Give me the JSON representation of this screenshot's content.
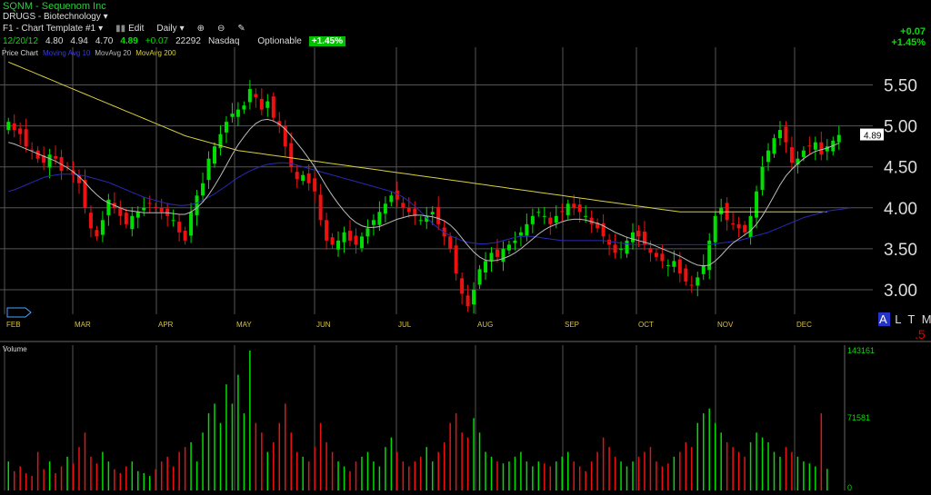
{
  "header": {
    "ticker_line": "SQNM - Sequenom Inc",
    "sector_line": "DRUGS - Biotechnology",
    "template": "F1 - Chart Template #1",
    "edit": "Edit",
    "period": "Daily",
    "zoom_in_icon": "zoom-in-icon",
    "zoom_out_icon": "zoom-out-icon",
    "draw_icon": "pencil-icon"
  },
  "quote": {
    "date": "12/20/12",
    "open": "4.80",
    "high": "4.94",
    "low": "4.70",
    "close": "4.89",
    "change": "+0.07",
    "volume": "22292",
    "exchange": "Nasdaq",
    "optionable": "Optionable",
    "pct_badge": "+1.45%",
    "right_change": "+0.07",
    "right_pct": "+1.45%"
  },
  "legend": {
    "price": "Price Chart",
    "ma10": "Moving Avg 10",
    "ma20": "MovAvg 20",
    "ma200": "MovAvg 200"
  },
  "controls": {
    "a": "A",
    "ltml": "L T M L",
    "five": ".5"
  },
  "colors": {
    "up": "#00dd00",
    "down": "#ee1111",
    "ma10": "#2a2ab8",
    "ma20": "#bbbbbb",
    "ma200": "#d8d040",
    "grid": "#555555",
    "axis_text": "#dddddd",
    "month_text": "#d8c040"
  },
  "chart_data": {
    "type": "candlestick",
    "price_axis": {
      "ylim": [
        2.7,
        5.85
      ],
      "ticks": [
        "5.50",
        "5.00",
        "4.50",
        "4.00",
        "3.50",
        "3.00"
      ],
      "last_label": "4.89"
    },
    "months": [
      "FEB",
      "MAR",
      "APR",
      "MAY",
      "JUN",
      "JUL",
      "AUG",
      "SEP",
      "OCT",
      "NOV",
      "DEC"
    ],
    "close": [
      5.05,
      4.95,
      4.9,
      4.75,
      4.7,
      4.6,
      4.55,
      4.65,
      4.6,
      4.45,
      4.5,
      4.4,
      4.3,
      4.0,
      3.75,
      3.65,
      3.85,
      4.1,
      4.0,
      3.9,
      3.8,
      3.9,
      3.95,
      4.0,
      4.05,
      4.0,
      3.95,
      3.9,
      3.85,
      3.7,
      3.6,
      3.95,
      4.15,
      4.3,
      4.6,
      4.75,
      4.9,
      5.05,
      5.15,
      5.2,
      5.25,
      5.45,
      5.35,
      5.2,
      5.3,
      5.1,
      5.0,
      4.75,
      4.5,
      4.35,
      4.4,
      4.3,
      4.2,
      3.85,
      3.6,
      3.55,
      3.6,
      3.7,
      3.6,
      3.55,
      3.65,
      3.75,
      3.85,
      3.95,
      4.05,
      4.15,
      4.1,
      4.0,
      3.95,
      3.9,
      3.85,
      3.9,
      3.95,
      3.8,
      3.65,
      3.5,
      3.2,
      2.95,
      2.8,
      3.0,
      3.25,
      3.35,
      3.45,
      3.4,
      3.5,
      3.55,
      3.6,
      3.7,
      3.8,
      3.9,
      3.95,
      3.9,
      3.8,
      3.9,
      3.95,
      4.05,
      4.0,
      3.95,
      3.9,
      3.8,
      3.75,
      3.65,
      3.55,
      3.45,
      3.5,
      3.6,
      3.7,
      3.65,
      3.55,
      3.45,
      3.4,
      3.35,
      3.3,
      3.35,
      3.2,
      3.1,
      3.05,
      3.15,
      3.3,
      3.6,
      3.9,
      4.0,
      3.85,
      3.8,
      3.75,
      3.7,
      3.9,
      4.2,
      4.5,
      4.7,
      4.85,
      4.95,
      4.8,
      4.55,
      4.6,
      4.7,
      4.75,
      4.8,
      4.65,
      4.75,
      4.82,
      4.89
    ],
    "ma20": [
      4.8,
      4.78,
      4.75,
      4.72,
      4.69,
      4.66,
      4.63,
      4.6,
      4.57,
      4.53,
      4.49,
      4.44,
      4.38,
      4.31,
      4.23,
      4.16,
      4.1,
      4.06,
      4.03,
      4.0,
      3.97,
      3.96,
      3.95,
      3.94,
      3.94,
      3.94,
      3.94,
      3.94,
      3.93,
      3.92,
      3.92,
      3.95,
      4.0,
      4.07,
      4.16,
      4.27,
      4.39,
      4.52,
      4.65,
      4.77,
      4.87,
      4.96,
      5.03,
      5.07,
      5.08,
      5.06,
      5.02,
      4.96,
      4.88,
      4.79,
      4.7,
      4.6,
      4.5,
      4.38,
      4.26,
      4.15,
      4.05,
      3.96,
      3.88,
      3.82,
      3.78,
      3.76,
      3.76,
      3.77,
      3.8,
      3.83,
      3.86,
      3.88,
      3.9,
      3.91,
      3.91,
      3.9,
      3.89,
      3.87,
      3.84,
      3.79,
      3.72,
      3.63,
      3.54,
      3.46,
      3.4,
      3.36,
      3.35,
      3.36,
      3.38,
      3.41,
      3.45,
      3.5,
      3.56,
      3.62,
      3.68,
      3.73,
      3.77,
      3.8,
      3.83,
      3.85,
      3.86,
      3.86,
      3.85,
      3.83,
      3.81,
      3.78,
      3.74,
      3.7,
      3.67,
      3.64,
      3.62,
      3.6,
      3.58,
      3.56,
      3.53,
      3.5,
      3.47,
      3.44,
      3.41,
      3.37,
      3.33,
      3.3,
      3.29,
      3.3,
      3.35,
      3.42,
      3.5,
      3.57,
      3.62,
      3.67,
      3.72,
      3.8,
      3.9,
      4.02,
      4.15,
      4.28,
      4.39,
      4.47,
      4.54,
      4.6,
      4.65,
      4.69,
      4.71,
      4.73,
      4.76,
      4.79
    ],
    "ma50": [
      4.2,
      4.22,
      4.25,
      4.28,
      4.31,
      4.34,
      4.37,
      4.39,
      4.4,
      4.41,
      4.41,
      4.41,
      4.4,
      4.39,
      4.37,
      4.35,
      4.33,
      4.31,
      4.28,
      4.25,
      4.22,
      4.19,
      4.16,
      4.13,
      4.11,
      4.09,
      4.07,
      4.05,
      4.04,
      4.03,
      4.03,
      4.04,
      4.06,
      4.09,
      4.13,
      4.17,
      4.22,
      4.27,
      4.32,
      4.37,
      4.41,
      4.45,
      4.48,
      4.51,
      4.53,
      4.54,
      4.55,
      4.55,
      4.54,
      4.52,
      4.5,
      4.48,
      4.46,
      4.44,
      4.42,
      4.4,
      4.38,
      4.36,
      4.34,
      4.32,
      4.3,
      4.28,
      4.26,
      4.24,
      4.22,
      4.2,
      4.17,
      4.13,
      4.08,
      4.02,
      3.95,
      3.88,
      3.81,
      3.75,
      3.7,
      3.66,
      3.63,
      3.6,
      3.58,
      3.57,
      3.56,
      3.56,
      3.57,
      3.58,
      3.6,
      3.62,
      3.64,
      3.65,
      3.65,
      3.65,
      3.64,
      3.63,
      3.62,
      3.61,
      3.6,
      3.6,
      3.6,
      3.6,
      3.6,
      3.6,
      3.6,
      3.6,
      3.59,
      3.58,
      3.57,
      3.56,
      3.55,
      3.55,
      3.55,
      3.55,
      3.55,
      3.55,
      3.55,
      3.55,
      3.55,
      3.55,
      3.55,
      3.55,
      3.55,
      3.55,
      3.56,
      3.57,
      3.58,
      3.59,
      3.6,
      3.62,
      3.64,
      3.66,
      3.68,
      3.7,
      3.73,
      3.76,
      3.79,
      3.82,
      3.85,
      3.88,
      3.9,
      3.92,
      3.94,
      3.96,
      3.97,
      3.98,
      3.99,
      4.0
    ],
    "ma200": [
      5.78,
      5.75,
      5.72,
      5.69,
      5.66,
      5.63,
      5.6,
      5.57,
      5.54,
      5.51,
      5.48,
      5.45,
      5.42,
      5.39,
      5.36,
      5.33,
      5.3,
      5.27,
      5.24,
      5.21,
      5.18,
      5.15,
      5.12,
      5.09,
      5.06,
      5.03,
      5.0,
      4.97,
      4.94,
      4.91,
      4.88,
      4.86,
      4.84,
      4.82,
      4.8,
      4.78,
      4.76,
      4.74,
      4.72,
      4.7,
      4.69,
      4.68,
      4.67,
      4.66,
      4.65,
      4.64,
      4.63,
      4.62,
      4.61,
      4.6,
      4.59,
      4.58,
      4.57,
      4.56,
      4.55,
      4.54,
      4.53,
      4.52,
      4.51,
      4.5,
      4.49,
      4.48,
      4.47,
      4.46,
      4.45,
      4.44,
      4.43,
      4.42,
      4.41,
      4.4,
      4.39,
      4.38,
      4.37,
      4.36,
      4.35,
      4.34,
      4.33,
      4.32,
      4.31,
      4.3,
      4.29,
      4.28,
      4.27,
      4.26,
      4.25,
      4.24,
      4.23,
      4.22,
      4.21,
      4.2,
      4.19,
      4.18,
      4.17,
      4.16,
      4.15,
      4.14,
      4.13,
      4.12,
      4.11,
      4.1,
      4.09,
      4.08,
      4.07,
      4.06,
      4.05,
      4.04,
      4.03,
      4.02,
      4.01,
      4.0,
      3.99,
      3.98,
      3.97,
      3.96,
      3.95,
      3.95,
      3.95,
      3.95,
      3.95,
      3.95,
      3.95,
      3.95,
      3.95,
      3.95,
      3.95,
      3.95,
      3.95,
      3.95,
      3.95,
      3.95,
      3.95,
      3.95,
      3.95,
      3.95,
      3.95,
      3.95,
      3.95,
      3.95,
      3.95,
      3.95
    ],
    "volume_axis": {
      "ylim": [
        0,
        143161
      ],
      "ticks": [
        "143161",
        "71581",
        "0"
      ],
      "label": "Volume"
    },
    "volume": [
      30000,
      20000,
      25000,
      18000,
      15000,
      40000,
      22000,
      30000,
      18000,
      25000,
      35000,
      28000,
      45000,
      60000,
      35000,
      28000,
      40000,
      30000,
      22000,
      18000,
      25000,
      30000,
      20000,
      18000,
      15000,
      22000,
      30000,
      35000,
      25000,
      40000,
      45000,
      50000,
      30000,
      60000,
      80000,
      90000,
      70000,
      110000,
      90000,
      120000,
      80000,
      145000,
      70000,
      60000,
      40000,
      50000,
      70000,
      90000,
      60000,
      40000,
      35000,
      30000,
      45000,
      70000,
      50000,
      40000,
      30000,
      25000,
      20000,
      30000,
      35000,
      40000,
      30000,
      25000,
      45000,
      55000,
      40000,
      30000,
      25000,
      30000,
      35000,
      45000,
      30000,
      40000,
      50000,
      70000,
      80000,
      60000,
      55000,
      75000,
      60000,
      40000,
      35000,
      30000,
      28000,
      30000,
      35000,
      40000,
      30000,
      25000,
      30000,
      28000,
      25000,
      30000,
      35000,
      40000,
      30000,
      25000,
      20000,
      30000,
      40000,
      55000,
      45000,
      35000,
      30000,
      25000,
      30000,
      35000,
      40000,
      45000,
      30000,
      25000,
      28000,
      35000,
      40000,
      50000,
      45000,
      70000,
      80000,
      85000,
      70000,
      60000,
      50000,
      45000,
      40000,
      35000,
      50000,
      60000,
      55000,
      50000,
      40000,
      35000,
      45000,
      40000,
      35000,
      30000,
      28000,
      25000,
      80000,
      22292
    ]
  }
}
